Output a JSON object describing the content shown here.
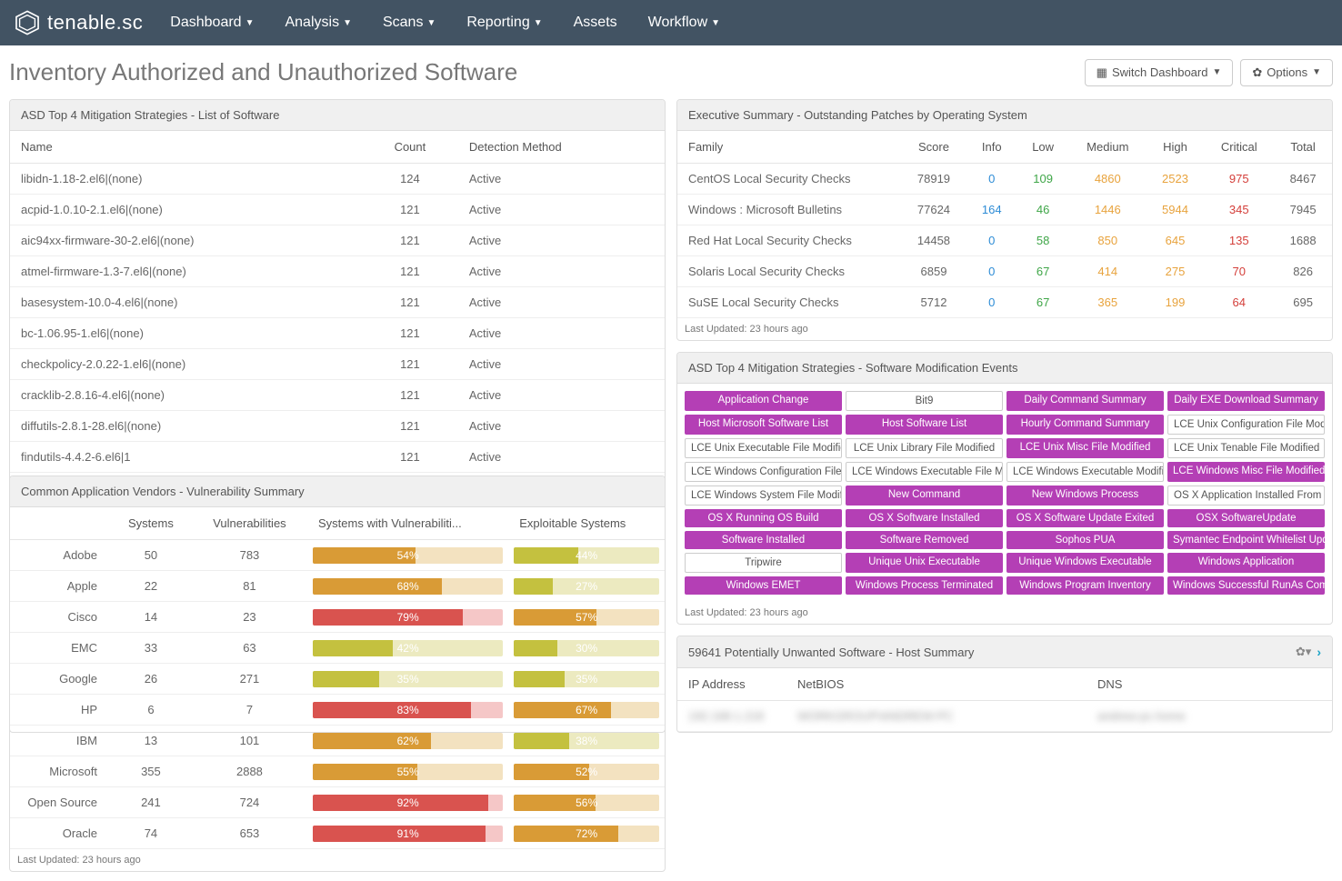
{
  "nav": {
    "brand": "tenable.sc",
    "items": [
      "Dashboard",
      "Analysis",
      "Scans",
      "Reporting",
      "Assets",
      "Workflow"
    ],
    "caret_idx": [
      0,
      1,
      2,
      3,
      5
    ]
  },
  "page": {
    "title": "Inventory Authorized and Unauthorized Software",
    "switch_btn": "Switch Dashboard",
    "options_btn": "Options"
  },
  "software_panel": {
    "title": "ASD Top 4 Mitigation Strategies - List of Software",
    "cols": [
      "Name",
      "Count",
      "Detection Method"
    ],
    "rows": [
      {
        "name": "libidn-1.18-2.el6|(none)",
        "count": 124,
        "method": "Active"
      },
      {
        "name": "acpid-1.0.10-2.1.el6|(none)",
        "count": 121,
        "method": "Active"
      },
      {
        "name": "aic94xx-firmware-30-2.el6|(none)",
        "count": 121,
        "method": "Active"
      },
      {
        "name": "atmel-firmware-1.3-7.el6|(none)",
        "count": 121,
        "method": "Active"
      },
      {
        "name": "basesystem-10.0-4.el6|(none)",
        "count": 121,
        "method": "Active"
      },
      {
        "name": "bc-1.06.95-1.el6|(none)",
        "count": 121,
        "method": "Active"
      },
      {
        "name": "checkpolicy-2.0.22-1.el6|(none)",
        "count": 121,
        "method": "Active"
      },
      {
        "name": "cracklib-2.8.16-4.el6|(none)",
        "count": 121,
        "method": "Active"
      },
      {
        "name": "diffutils-2.8.1-28.el6|(none)",
        "count": 121,
        "method": "Active"
      },
      {
        "name": "findutils-4.4.2-6.el6|1",
        "count": 121,
        "method": "Active"
      }
    ],
    "footer": "Last Updated: 23 hours ago"
  },
  "exec_panel": {
    "title": "Executive Summary - Outstanding Patches by Operating System",
    "cols": [
      "Family",
      "Score",
      "Info",
      "Low",
      "Medium",
      "High",
      "Critical",
      "Total"
    ],
    "rows": [
      {
        "family": "CentOS Local Security Checks",
        "score": 78919,
        "info": 0,
        "low": 109,
        "med": 4860,
        "high": 2523,
        "crit": 975,
        "total": 8467
      },
      {
        "family": "Windows : Microsoft Bulletins",
        "score": 77624,
        "info": 164,
        "low": 46,
        "med": 1446,
        "high": 5944,
        "crit": 345,
        "total": 7945
      },
      {
        "family": "Red Hat Local Security Checks",
        "score": 14458,
        "info": 0,
        "low": 58,
        "med": 850,
        "high": 645,
        "crit": 135,
        "total": 1688
      },
      {
        "family": "Solaris Local Security Checks",
        "score": 6859,
        "info": 0,
        "low": 67,
        "med": 414,
        "high": 275,
        "crit": 70,
        "total": 826
      },
      {
        "family": "SuSE Local Security Checks",
        "score": 5712,
        "info": 0,
        "low": 67,
        "med": 365,
        "high": 199,
        "crit": 64,
        "total": 695
      }
    ],
    "footer": "Last Updated: 23 hours ago"
  },
  "vendor_panel": {
    "title": "Common Application Vendors - Vulnerability Summary",
    "cols": [
      "",
      "Systems",
      "Vulnerabilities",
      "Systems with Vulnerabiliti...",
      "Exploitable Systems"
    ],
    "rows": [
      {
        "vendor": "Adobe",
        "sys": 50,
        "vuln": 783,
        "pct1": 54,
        "pct2": 44
      },
      {
        "vendor": "Apple",
        "sys": 22,
        "vuln": 81,
        "pct1": 68,
        "pct2": 27
      },
      {
        "vendor": "Cisco",
        "sys": 14,
        "vuln": 23,
        "pct1": 79,
        "pct2": 57
      },
      {
        "vendor": "EMC",
        "sys": 33,
        "vuln": 63,
        "pct1": 42,
        "pct2": 30
      },
      {
        "vendor": "Google",
        "sys": 26,
        "vuln": 271,
        "pct1": 35,
        "pct2": 35
      },
      {
        "vendor": "HP",
        "sys": 6,
        "vuln": 7,
        "pct1": 83,
        "pct2": 67
      },
      {
        "vendor": "IBM",
        "sys": 13,
        "vuln": 101,
        "pct1": 62,
        "pct2": 38
      },
      {
        "vendor": "Microsoft",
        "sys": 355,
        "vuln": 2888,
        "pct1": 55,
        "pct2": 52
      },
      {
        "vendor": "Open Source",
        "sys": 241,
        "vuln": 724,
        "pct1": 92,
        "pct2": 56
      },
      {
        "vendor": "Oracle",
        "sys": 74,
        "vuln": 653,
        "pct1": 91,
        "pct2": 72
      }
    ],
    "footer": "Last Updated: 23 hours ago"
  },
  "events_panel": {
    "title": "ASD Top 4 Mitigation Strategies - Software Modification Events",
    "tags": [
      {
        "t": "Application Change",
        "f": 1
      },
      {
        "t": "Bit9",
        "f": 0
      },
      {
        "t": "Daily Command Summary",
        "f": 1
      },
      {
        "t": "Daily EXE Download Summary",
        "f": 1
      },
      {
        "t": "Host Microsoft Software List",
        "f": 1
      },
      {
        "t": "Host Software List",
        "f": 1
      },
      {
        "t": "Hourly Command Summary",
        "f": 1
      },
      {
        "t": "LCE Unix Configuration File Modif",
        "f": 0
      },
      {
        "t": "LCE Unix Executable File Modified",
        "f": 0
      },
      {
        "t": "LCE Unix Library File Modified",
        "f": 0
      },
      {
        "t": "LCE Unix Misc File Modified",
        "f": 1
      },
      {
        "t": "LCE Unix Tenable File Modified",
        "f": 0
      },
      {
        "t": "LCE Windows Configuration File M",
        "f": 0
      },
      {
        "t": "LCE Windows Executable File Mo",
        "f": 0
      },
      {
        "t": "LCE Windows Executable Modifie",
        "f": 0
      },
      {
        "t": "LCE Windows Misc File Modified",
        "f": 1
      },
      {
        "t": "LCE Windows System File Modifie",
        "f": 0
      },
      {
        "t": "New Command",
        "f": 1
      },
      {
        "t": "New Windows Process",
        "f": 1
      },
      {
        "t": "OS X Application Installed From R",
        "f": 0
      },
      {
        "t": "OS X Running OS Build",
        "f": 1
      },
      {
        "t": "OS X Software Installed",
        "f": 1
      },
      {
        "t": "OS X Software Update Exited",
        "f": 1
      },
      {
        "t": "OSX SoftwareUpdate",
        "f": 1
      },
      {
        "t": "Software Installed",
        "f": 1
      },
      {
        "t": "Software Removed",
        "f": 1
      },
      {
        "t": "Sophos PUA",
        "f": 1
      },
      {
        "t": "Symantec Endpoint Whitelist Upd",
        "f": 1
      },
      {
        "t": "Tripwire",
        "f": 0
      },
      {
        "t": "Unique Unix Executable",
        "f": 1
      },
      {
        "t": "Unique Windows Executable",
        "f": 1
      },
      {
        "t": "Windows Application",
        "f": 1
      },
      {
        "t": "Windows EMET",
        "f": 1
      },
      {
        "t": "Windows Process Terminated",
        "f": 1
      },
      {
        "t": "Windows Program Inventory",
        "f": 1
      },
      {
        "t": "Windows Successful RunAs Com",
        "f": 1
      }
    ],
    "footer": "Last Updated: 23 hours ago"
  },
  "pus_panel": {
    "title": "59641 Potentially Unwanted Software - Host Summary",
    "cols": [
      "IP Address",
      "NetBIOS",
      "DNS"
    ]
  }
}
